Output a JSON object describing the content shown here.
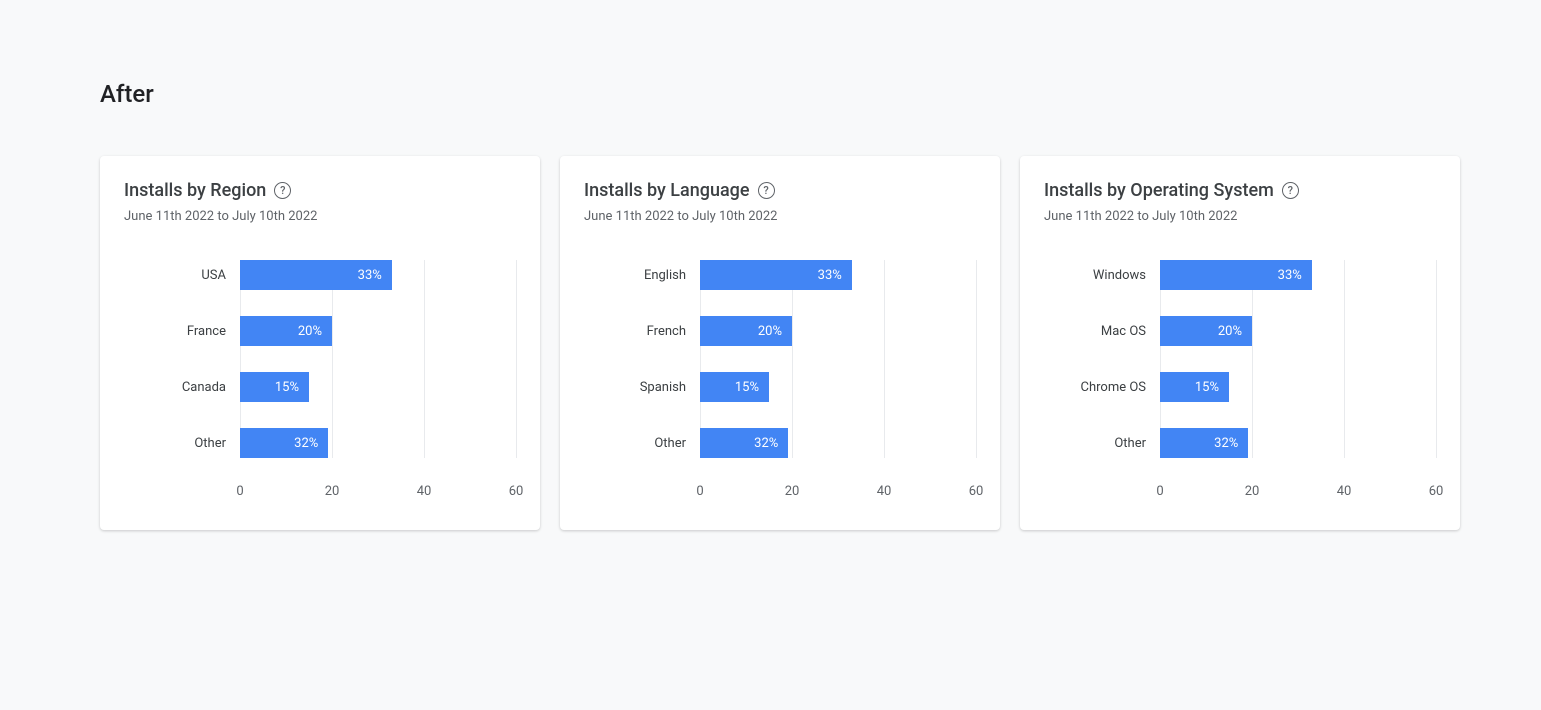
{
  "page_title": "After",
  "date_range": "June 11th 2022 to July 10th 2022",
  "axis": {
    "max": 60,
    "ticks": [
      0,
      20,
      40,
      60
    ]
  },
  "bar_color": "#4285f4",
  "cards": [
    {
      "title": "Installs by Region",
      "items": [
        {
          "label": "USA",
          "value": 33,
          "display": "33%"
        },
        {
          "label": "France",
          "value": 20,
          "display": "20%"
        },
        {
          "label": "Canada",
          "value": 15,
          "display": "15%"
        },
        {
          "label": "Other",
          "value": 32,
          "display": "32%",
          "shrink": true
        }
      ]
    },
    {
      "title": "Installs by Language",
      "items": [
        {
          "label": "English",
          "value": 33,
          "display": "33%"
        },
        {
          "label": "French",
          "value": 20,
          "display": "20%"
        },
        {
          "label": "Spanish",
          "value": 15,
          "display": "15%"
        },
        {
          "label": "Other",
          "value": 32,
          "display": "32%",
          "shrink": true
        }
      ]
    },
    {
      "title": "Installs by Operating System",
      "items": [
        {
          "label": "Windows",
          "value": 33,
          "display": "33%"
        },
        {
          "label": "Mac OS",
          "value": 20,
          "display": "20%"
        },
        {
          "label": "Chrome OS",
          "value": 15,
          "display": "15%"
        },
        {
          "label": "Other",
          "value": 32,
          "display": "32%",
          "shrink": true
        }
      ]
    }
  ],
  "chart_data": [
    {
      "type": "bar",
      "title": "Installs by Region",
      "subtitle": "June 11th 2022 to July 10th 2022",
      "categories": [
        "USA",
        "France",
        "Canada",
        "Other"
      ],
      "values": [
        33,
        20,
        15,
        32
      ],
      "xlabel": "",
      "ylabel": "",
      "xlim": [
        0,
        60
      ],
      "x_ticks": [
        0,
        20,
        40,
        60
      ],
      "orientation": "horizontal"
    },
    {
      "type": "bar",
      "title": "Installs by Language",
      "subtitle": "June 11th 2022 to July 10th 2022",
      "categories": [
        "English",
        "French",
        "Spanish",
        "Other"
      ],
      "values": [
        33,
        20,
        15,
        32
      ],
      "xlabel": "",
      "ylabel": "",
      "xlim": [
        0,
        60
      ],
      "x_ticks": [
        0,
        20,
        40,
        60
      ],
      "orientation": "horizontal"
    },
    {
      "type": "bar",
      "title": "Installs by Operating System",
      "subtitle": "June 11th 2022 to July 10th 2022",
      "categories": [
        "Windows",
        "Mac OS",
        "Chrome OS",
        "Other"
      ],
      "values": [
        33,
        20,
        15,
        32
      ],
      "xlabel": "",
      "ylabel": "",
      "xlim": [
        0,
        60
      ],
      "x_ticks": [
        0,
        20,
        40,
        60
      ],
      "orientation": "horizontal"
    }
  ]
}
